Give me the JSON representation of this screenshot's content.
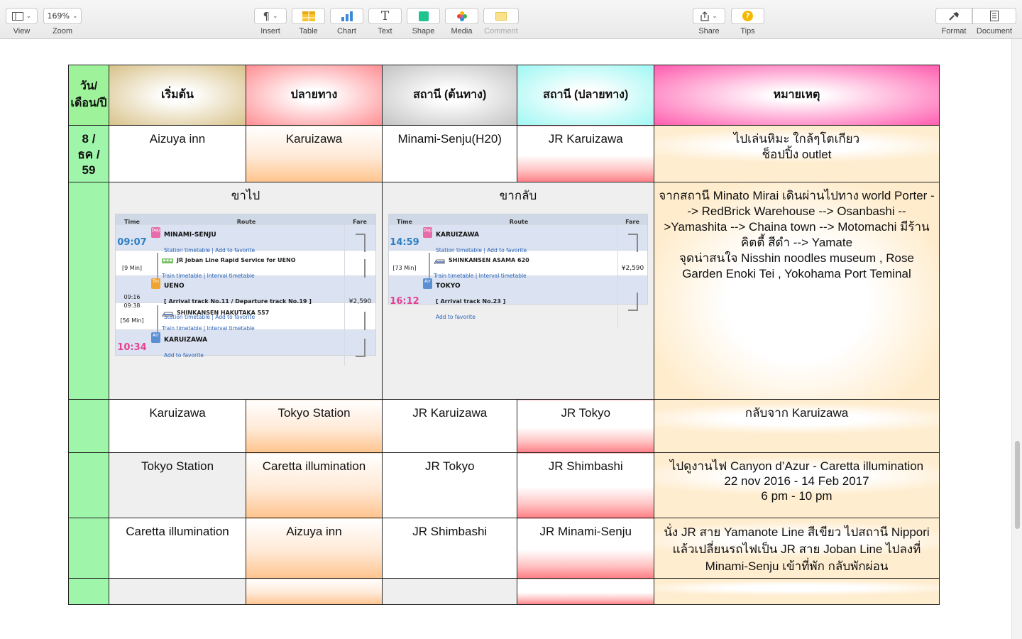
{
  "toolbar": {
    "view": "View",
    "zoom_value": "169%",
    "zoom": "Zoom",
    "insert": "Insert",
    "table": "Table",
    "chart": "Chart",
    "text": "Text",
    "shape": "Shape",
    "media": "Media",
    "comment": "Comment",
    "share": "Share",
    "tips": "Tips",
    "format": "Format",
    "document": "Document"
  },
  "table": {
    "headers": [
      "วัน/เดือน/ปี",
      "เริ่มต้น",
      "ปลายทาง",
      "สถานี (ต้นทาง)",
      "สถานี (ปลายทาง)",
      "หมายเหตุ"
    ],
    "date_lines": [
      "8 /",
      "ธค /",
      "59"
    ],
    "row1": {
      "start": "Aizuya inn",
      "dest": "Karuizawa",
      "from_station": "Minami-Senju(H20)",
      "to_station": "JR Karuizawa",
      "note_line1": "ไปเล่นหิมะ ใกล้ๆโตเกียว",
      "note_line2": "ช็อปปิ้ง outlet"
    },
    "row2": {
      "outbound_title": "ขาไป",
      "return_title": "ขากลับ",
      "note_line1": "จากสถานี Minato Mirai เดินผ่านไปทาง world Porter --> RedBrick Warehouse --> Osanbashi -->Yamashita --> Chaina town --> Motomachi มีร้านคิตตี้ สีดำ --> Yamate",
      "note_line2": "จุดน่าสนใจ Nisshin noodles museum , Rose Garden Enoki Tei , Yokohama Port Teminal"
    },
    "row3": {
      "start": "Karuizawa",
      "dest": "Tokyo Station",
      "from_station": "JR Karuizawa",
      "to_station": "JR Tokyo",
      "note": "กลับจาก Karuizawa"
    },
    "row4": {
      "start": "Tokyo Station",
      "dest": "Caretta illumination",
      "from_station": "JR Tokyo",
      "to_station": "JR Shimbashi",
      "note_line1": "ไปดูงานไฟ Canyon d’Azur - Caretta illumination",
      "note_line2": "22 nov 2016 - 14 Feb 2017",
      "note_line3": "6 pm - 10 pm"
    },
    "row5": {
      "start": "Caretta illumination",
      "dest": "Aizuya inn",
      "from_station": "JR Shimbashi",
      "to_station": "JR Minami-Senju",
      "note_line1": "นั่ง JR สาย Yamanote Line สีเขียว ไปสถานี Nippori",
      "note_line2": "แล้วเปลี่ยนรถไฟเป็น JR สาย Joban Line ไปลงที่",
      "note_line3": "Minami-Senju เข้าที่พัก กลับพักผ่อน"
    }
  },
  "route_out": {
    "head": [
      "Time",
      "Route",
      "Fare"
    ],
    "dep_time": "09:07",
    "dep_badge": "Dep",
    "dep_station": "MINAMI-SENJU",
    "dep_links": "Station timetable | Add to favorite",
    "leg1_duration": "[9 Min]",
    "leg1_line": "JR Joban Line Rapid Service  for UENO",
    "leg1_links": "Train timetable | Interval timetable",
    "tr_time1": "09:16",
    "tr_time2": "09:38",
    "tr_badge": "Trn",
    "tr_station": "UENO",
    "tr_track": "[ Arrival track No.11 / Departure track No.19 ]",
    "tr_links": "Station timetable | Add to favorite",
    "fare": "¥2,590",
    "leg2_duration": "[56 Min]",
    "leg2_line": "SHINKANSEN HAKUTAKA 557",
    "leg2_links": "Train timetable | Interval timetable",
    "arr_time": "10:34",
    "arr_badge": "Arr",
    "arr_station": "KARUIZAWA",
    "arr_links": "Add to favorite"
  },
  "route_back": {
    "head": [
      "Time",
      "Route",
      "Fare"
    ],
    "dep_time": "14:59",
    "dep_badge": "Dep",
    "dep_station": "KARUIZAWA",
    "dep_links": "Station timetable | Add to favorite",
    "leg_duration": "[73 Min]",
    "leg_line": "SHINKANSEN ASAMA 620",
    "leg_links": "Train timetable | Interval timetable",
    "fare": "¥2,590",
    "arr_time": "16:12",
    "arr_badge": "Arr",
    "arr_station": "TOKYO",
    "arr_track": "[ Arrival track No.23 ]",
    "arr_links": "Add to favorite"
  }
}
